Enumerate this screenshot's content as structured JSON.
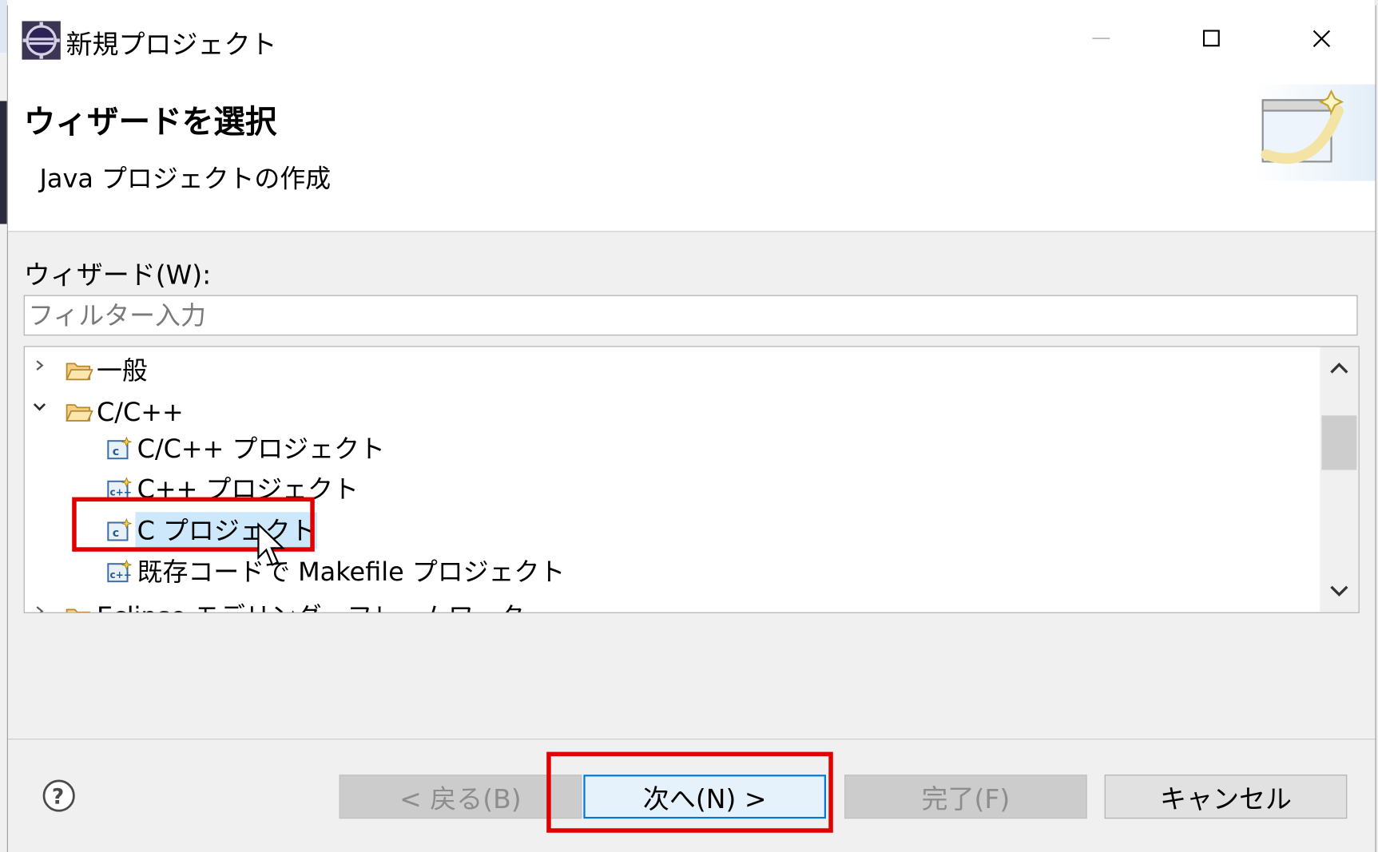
{
  "window": {
    "title": "新規プロジェクト"
  },
  "banner": {
    "title": "ウィザードを選択",
    "description": "Java プロジェクトの作成"
  },
  "wizards": {
    "label": "ウィザード(W):",
    "filter_placeholder": "フィルター入力",
    "filter_value": "",
    "tree": [
      {
        "label": "一般",
        "expanded": false,
        "icon": "folder-icon"
      },
      {
        "label": "C/C++",
        "expanded": true,
        "icon": "folder-icon"
      },
      {
        "label": "C/C++ プロジェクト",
        "icon": "c-project-icon"
      },
      {
        "label": "C++ プロジェクト",
        "icon": "cpp-project-icon"
      },
      {
        "label": "C プロジェクト",
        "icon": "c-project-icon",
        "selected": true
      },
      {
        "label": "既存コードで Makefile プロジェクト",
        "icon": "cpp-project-icon"
      },
      {
        "label": "Eclipse モデリング・フレームワーク",
        "expanded": false,
        "icon": "folder-icon"
      }
    ]
  },
  "buttons": {
    "back": "< 戻る(B)",
    "next": "次へ(N) >",
    "finish": "完了(F)",
    "cancel": "キャンセル"
  },
  "colors": {
    "highlight": "#e00000",
    "selection": "#cde8fb",
    "default_button_border": "#0078d7"
  }
}
